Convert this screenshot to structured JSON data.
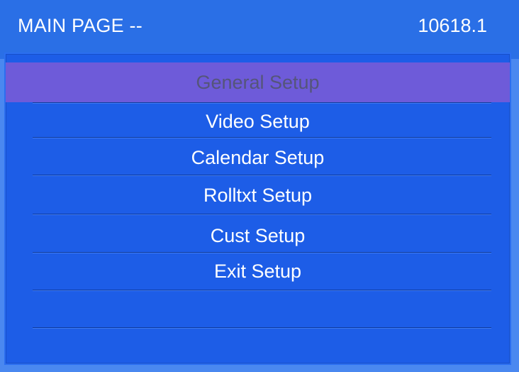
{
  "header": {
    "title": "MAIN PAGE --",
    "version": "10618.1"
  },
  "menu": {
    "items": [
      {
        "label": "General Setup",
        "selected": true
      },
      {
        "label": "Video Setup",
        "selected": false
      },
      {
        "label": "Calendar Setup",
        "selected": false
      },
      {
        "label": "Rolltxt Setup",
        "selected": false
      },
      {
        "label": "Cust Setup",
        "selected": false
      },
      {
        "label": "Exit Setup",
        "selected": false
      }
    ]
  },
  "colors": {
    "background": "#4a88f0",
    "titlebar": "#2a6fe6",
    "panel": "#1d5de7",
    "highlight": "#6e5bd9",
    "text": "#ffffff",
    "selected_text": "#55557a"
  }
}
